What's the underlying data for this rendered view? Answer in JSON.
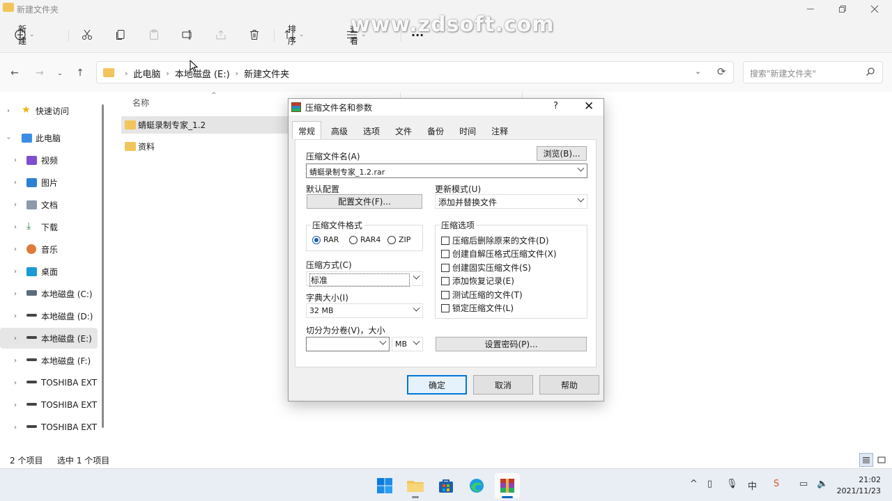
{
  "window": {
    "title": "新建文件夹"
  },
  "toolbar": {
    "new_label": "新建",
    "sort_label": "排序",
    "view_label": "查看",
    "more_label": "···"
  },
  "watermark": "www.zdsoft.com",
  "address": {
    "crumbs": [
      "此电脑",
      "本地磁盘 (E:)",
      "新建文件夹"
    ]
  },
  "search": {
    "placeholder": "搜索\"新建文件夹\""
  },
  "sidebar": {
    "items": [
      {
        "label": "快速访问",
        "icon": "star-icon"
      },
      {
        "label": "此电脑",
        "icon": "computer-icon"
      },
      {
        "label": "视频",
        "icon": "video-icon"
      },
      {
        "label": "图片",
        "icon": "pictures-icon"
      },
      {
        "label": "文档",
        "icon": "documents-icon"
      },
      {
        "label": "下载",
        "icon": "download-icon"
      },
      {
        "label": "音乐",
        "icon": "music-icon"
      },
      {
        "label": "桌面",
        "icon": "desktop-icon"
      },
      {
        "label": "本地磁盘 (C:)",
        "icon": "drive-icon"
      },
      {
        "label": "本地磁盘 (D:)",
        "icon": "drive-icon"
      },
      {
        "label": "本地磁盘 (E:)",
        "icon": "drive-icon"
      },
      {
        "label": "本地磁盘 (F:)",
        "icon": "drive-icon"
      },
      {
        "label": "TOSHIBA EXT",
        "icon": "drive-icon"
      },
      {
        "label": "TOSHIBA EXT",
        "icon": "drive-icon"
      },
      {
        "label": "TOSHIBA EXT",
        "icon": "drive-icon"
      }
    ]
  },
  "filelist": {
    "column_name": "名称",
    "files": [
      {
        "name": "蜻蜓录制专家_1.2",
        "selected": true
      },
      {
        "name": "资料",
        "selected": false
      }
    ]
  },
  "status": {
    "count": "2 个项目",
    "selected": "选中 1 个项目"
  },
  "dialog": {
    "title": "压缩文件名和参数",
    "help": "?",
    "tabs": [
      "常规",
      "高级",
      "选项",
      "文件",
      "备份",
      "时间",
      "注释"
    ],
    "archive_name_label": "压缩文件名(A)",
    "browse_label": "浏览(B)...",
    "archive_name_value": "蜻蜓录制专家_1.2.rar",
    "default_profile_label": "默认配置",
    "profiles_button": "配置文件(F)...",
    "update_mode_label": "更新模式(U)",
    "update_mode_value": "添加并替换文件",
    "format_group": "压缩文件格式",
    "formats": [
      {
        "label": "RAR",
        "checked": true
      },
      {
        "label": "RAR4",
        "checked": false
      },
      {
        "label": "ZIP",
        "checked": false
      }
    ],
    "method_label": "压缩方式(C)",
    "method_value": "标准",
    "dict_label": "字典大小(I)",
    "dict_value": "32 MB",
    "split_label": "切分为分卷(V)，大小",
    "split_value": "",
    "split_unit": "MB",
    "options_group": "压缩选项",
    "options": [
      "压缩后删除原来的文件(D)",
      "创建自解压格式压缩文件(X)",
      "创建固实压缩文件(S)",
      "添加恢复记录(E)",
      "测试压缩的文件(T)",
      "锁定压缩文件(L)"
    ],
    "password_button": "设置密码(P)...",
    "ok": "确定",
    "cancel": "取消",
    "help_button": "帮助"
  },
  "taskbar": {
    "time": "21:02",
    "date": "2021/11/23"
  },
  "colors": {
    "folder": "#f2c55c",
    "accent": "#0078d7"
  }
}
